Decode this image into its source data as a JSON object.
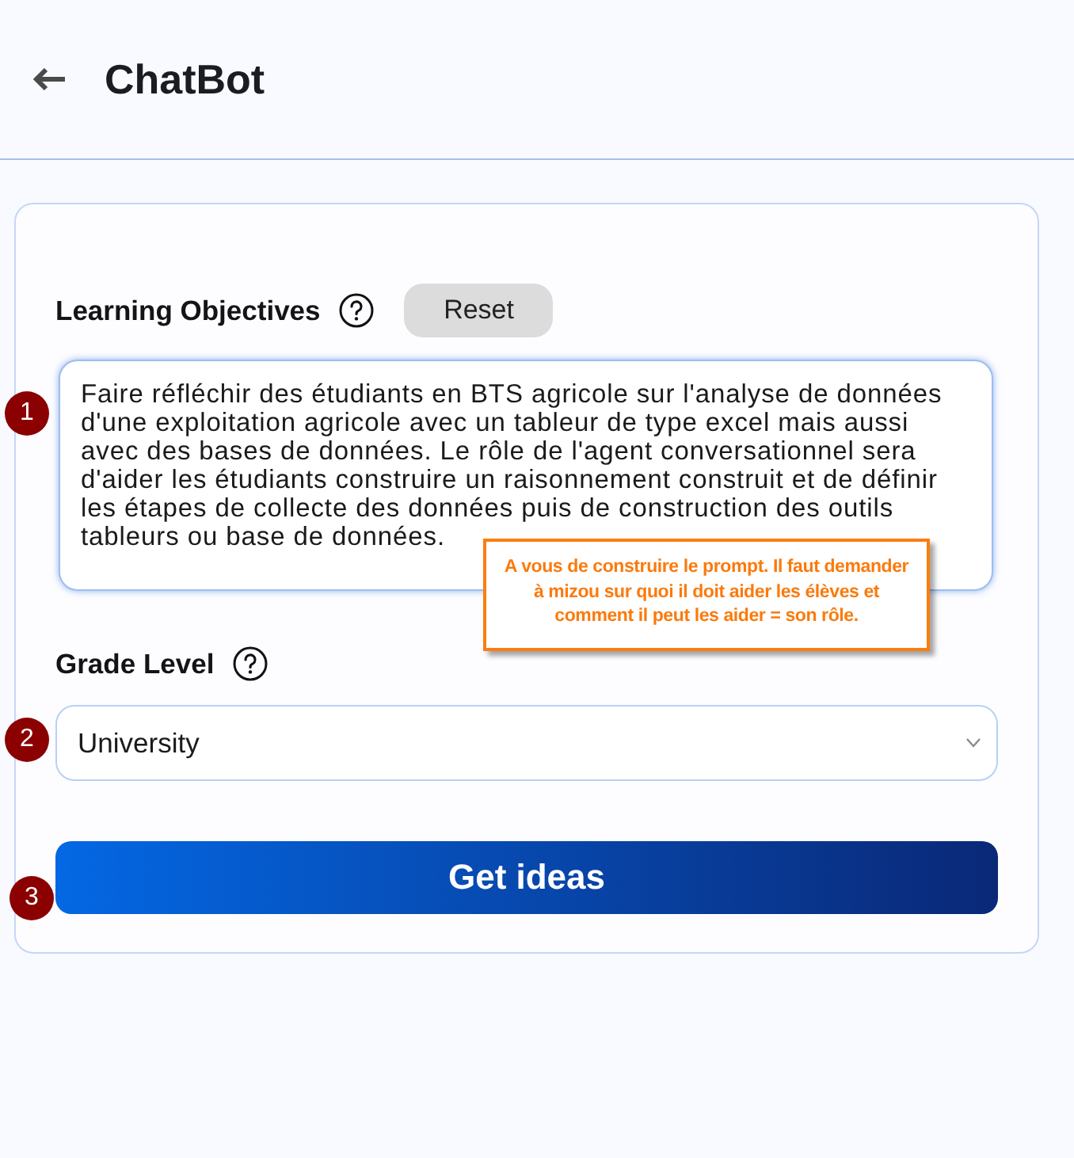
{
  "header": {
    "title": "ChatBot"
  },
  "form": {
    "learning_objectives": {
      "label": "Learning Objectives",
      "reset_button": "Reset",
      "value": "Faire réfléchir des étudiants en BTS agricole sur l'analyse de données d'une exploitation agricole avec un tableur de type excel mais aussi avec des bases de données. Le rôle de l'agent conversationnel sera d'aider les étudiants construire un raisonnement construit et de définir les étapes de collecte des données puis de construction des outils tableurs ou base de données."
    },
    "grade_level": {
      "label": "Grade Level",
      "value": "University"
    },
    "submit_button": "Get ideas"
  },
  "annotations": {
    "markers": [
      {
        "number": "1"
      },
      {
        "number": "2"
      },
      {
        "number": "3"
      }
    ],
    "callout": "A vous de construire le prompt. Il faut demander à mizou sur quoi il doit aider les élèves et comment il peut les aider = son rôle."
  }
}
